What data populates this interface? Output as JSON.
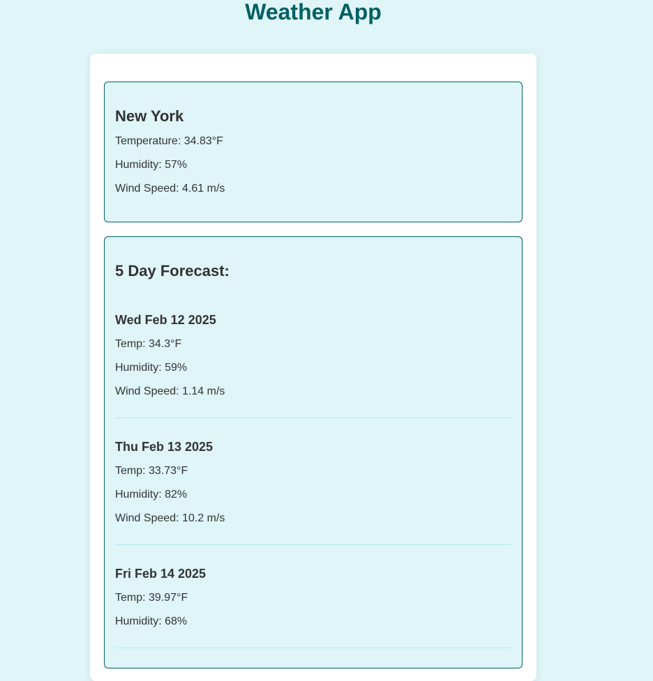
{
  "app": {
    "title": "Weather App"
  },
  "current": {
    "city": "New York",
    "temperature": "Temperature: 34.83°F",
    "humidity": "Humidity: 57%",
    "wind": "Wind Speed: 4.61 m/s"
  },
  "forecast": {
    "heading": "5 Day Forecast:",
    "days": [
      {
        "date": "Wed Feb 12 2025",
        "temp": "Temp: 34.3°F",
        "humidity": "Humidity: 59%",
        "wind": "Wind Speed: 1.14 m/s"
      },
      {
        "date": "Thu Feb 13 2025",
        "temp": "Temp: 33.73°F",
        "humidity": "Humidity: 82%",
        "wind": "Wind Speed: 10.2 m/s"
      },
      {
        "date": "Fri Feb 14 2025",
        "temp": "Temp: 39.97°F",
        "humidity": "Humidity: 68%"
      }
    ]
  },
  "colors": {
    "background": "#dff5f8",
    "accent": "#006064",
    "card": "#ffffff",
    "divider": "#b2ebf2",
    "text": "#333333"
  }
}
